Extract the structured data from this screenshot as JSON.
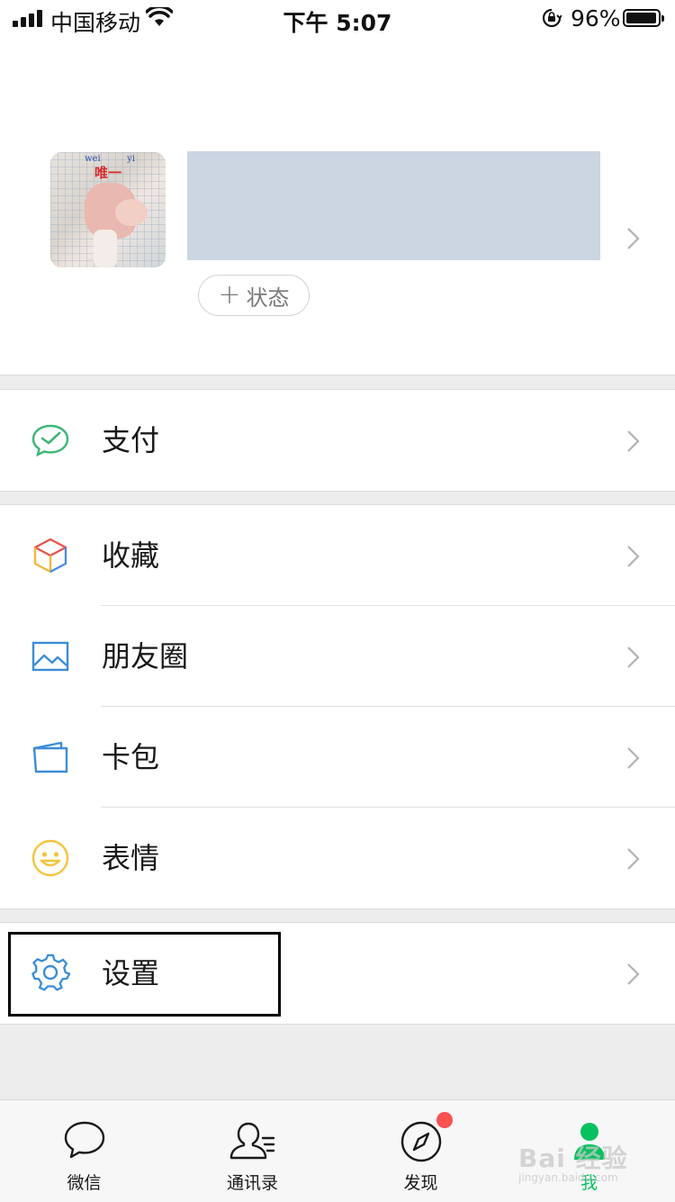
{
  "status_bar": {
    "carrier": "中国移动",
    "time": "下午 5:07",
    "battery_percent": "96%",
    "battery_level": 0.96,
    "icons": [
      "signal-icon",
      "wifi-icon",
      "rotation-lock-icon",
      "battery-icon"
    ]
  },
  "profile": {
    "avatar_caption_top_left": "wei",
    "avatar_caption_top_right": "yi",
    "avatar_caption": "唯一",
    "status_button_plus": "+",
    "status_button_label": "状态"
  },
  "menu": {
    "pay": "支付",
    "favorites": "收藏",
    "moments": "朋友圈",
    "cards": "卡包",
    "stickers": "表情",
    "settings": "设置"
  },
  "tabs": [
    {
      "label": "微信",
      "icon": "chat-bubble-icon"
    },
    {
      "label": "通讯录",
      "icon": "contacts-icon"
    },
    {
      "label": "发现",
      "icon": "compass-icon"
    },
    {
      "label": "我",
      "icon": "me-icon"
    }
  ],
  "watermark": {
    "brand": "Bai 经验",
    "url": "jingyan.baidu.com"
  },
  "colors": {
    "accent_green": "#07c160",
    "badge_red": "#fa5151",
    "name_placeholder": "#ccd5e2",
    "background": "#ededed"
  }
}
